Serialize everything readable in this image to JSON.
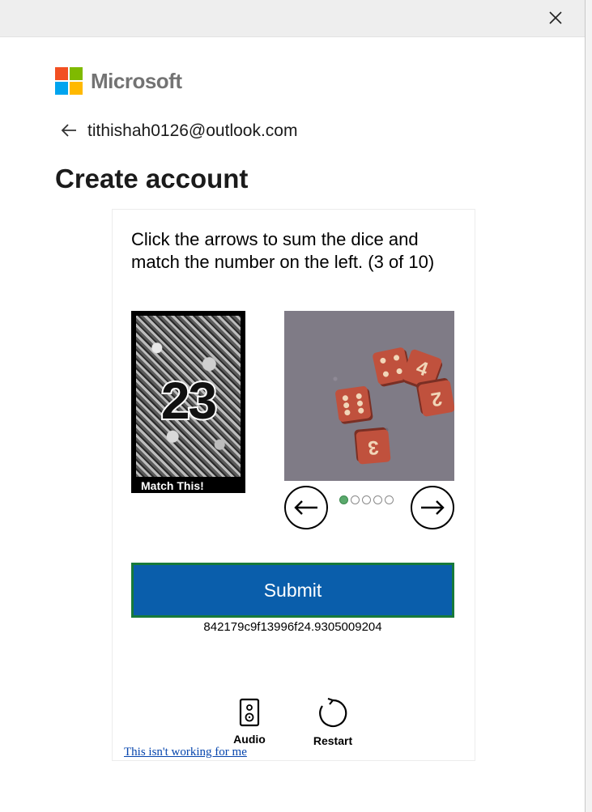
{
  "window": {
    "close_icon": "close-icon"
  },
  "brand": {
    "name": "Microsoft",
    "colors": [
      "#f25022",
      "#7fba00",
      "#00a4ef",
      "#ffb900"
    ]
  },
  "header": {
    "back_icon": "arrow-left-icon",
    "email": "tithishah0126@outlook.com",
    "title": "Create account"
  },
  "challenge": {
    "instructions": "Click the arrows to sum the dice and match the number on the left. (3 of 10)",
    "target_number": "23",
    "target_label": "Match This!",
    "dice_faces": [
      "3",
      "4",
      "2",
      "3"
    ],
    "prev_icon": "arrow-left-circle-icon",
    "next_icon": "arrow-right-circle-icon",
    "image_count": 5,
    "image_index": 1,
    "submit_label": "Submit",
    "session_id": "842179c9f13996f24.9305009204",
    "audio_label": "Audio",
    "restart_label": "Restart",
    "help_link": "This isn't working for me"
  },
  "colors": {
    "submit_bg": "#0a5eab",
    "submit_border": "#177a3a",
    "dot_active": "#5aa96c",
    "die_color": "#c0513d"
  }
}
